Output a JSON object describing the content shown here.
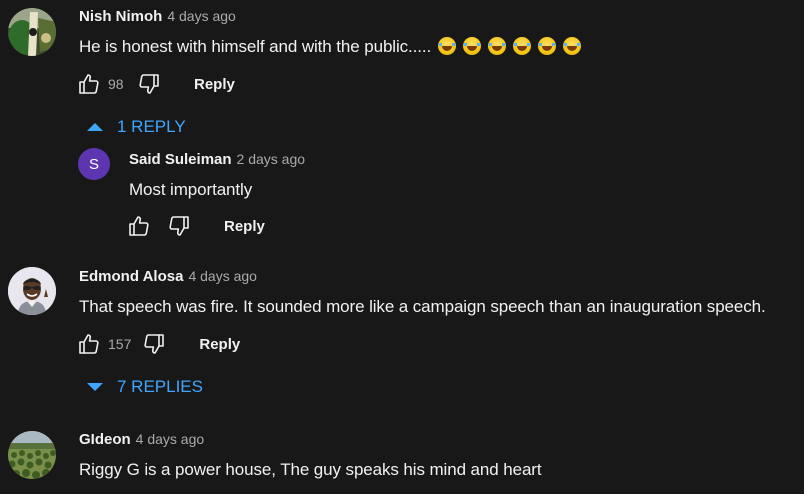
{
  "comments": [
    {
      "author": "Nish Nimoh",
      "time": "4 days ago",
      "text": "He is honest with himself and with the public.....",
      "emoji_count": 6,
      "likes": "98",
      "reply_label": "Reply",
      "avatar_icon": "video-thumbnail-avatar",
      "replies_toggle": {
        "label": "1 REPLY",
        "state": "expanded"
      },
      "replies": [
        {
          "author": "Said Suleiman",
          "time": "2 days ago",
          "text": "Most importantly",
          "likes": "",
          "reply_label": "Reply",
          "avatar_letter": "S",
          "avatar_color": "#5e35b1"
        }
      ]
    },
    {
      "author": "Edmond Alosa",
      "time": "4 days ago",
      "text": "That speech was fire. It sounded more like a campaign speech than an inauguration speech.",
      "likes": "157",
      "reply_label": "Reply",
      "avatar_icon": "cartoon-person-avatar",
      "replies_toggle": {
        "label": "7 REPLIES",
        "state": "collapsed"
      }
    },
    {
      "author": "GIdeon",
      "time": "4 days ago",
      "text": "Riggy G is a power house, The guy speaks his mind and heart",
      "avatar_icon": "landscape-photo-avatar"
    }
  ],
  "colors": {
    "background": "#181818",
    "link_blue": "#3ea6ff",
    "secondary_text": "#aaaaaa",
    "primary_text": "#f1f1f1"
  }
}
